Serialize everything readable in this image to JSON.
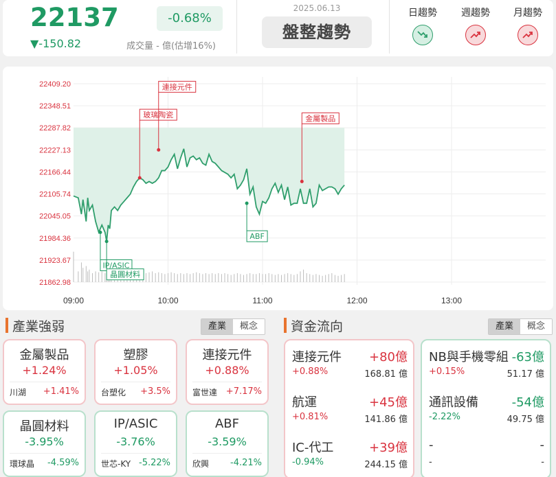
{
  "header": {
    "index_value": "22137",
    "change": "▼-150.82",
    "change_pct": "-0.68%",
    "volume": "成交量 - 億(估增16%)",
    "date": "2025.06.13",
    "trend_label": "盤整趨勢",
    "trends": [
      {
        "label": "日趨勢",
        "direction": "down",
        "color": "#2f9e6c"
      },
      {
        "label": "週趨勢",
        "direction": "up",
        "color": "#d9333f"
      },
      {
        "label": "月趨勢",
        "direction": "up",
        "color": "#d9333f"
      }
    ]
  },
  "chart_data": {
    "type": "line",
    "y_ticks": [
      "22409.20",
      "22348.51",
      "22287.82",
      "22227.13",
      "22166.44",
      "22105.74",
      "22045.05",
      "21984.36",
      "21923.67",
      "21862.98"
    ],
    "ylim": [
      21862.98,
      22409.2
    ],
    "x_ticks": [
      "09:00",
      "10:00",
      "11:00",
      "12:00",
      "13:00"
    ],
    "x_range_minutes": [
      0,
      270
    ],
    "reference_value": 22287.82,
    "series": [
      {
        "x": [
          0,
          3,
          5,
          6,
          8,
          9,
          10,
          12,
          14,
          16,
          18,
          20,
          21,
          22,
          23,
          24,
          26,
          28,
          30,
          32,
          34,
          36,
          38,
          40,
          42,
          44,
          46,
          48,
          50,
          52,
          54,
          56,
          58,
          60,
          62,
          64,
          66,
          68,
          70,
          72,
          74,
          76,
          78,
          80,
          82,
          84,
          86,
          88,
          90,
          92,
          94,
          96,
          98,
          100,
          102,
          104,
          106,
          108,
          110,
          112,
          114,
          116,
          118,
          120,
          122,
          124,
          126,
          128,
          130,
          132,
          134,
          136,
          138,
          140,
          142,
          144,
          146,
          148,
          150,
          152,
          154,
          156,
          158,
          160,
          162,
          164,
          166,
          168,
          170,
          172
        ],
        "values": [
          22100,
          22095,
          22050,
          22090,
          22030,
          22095,
          22060,
          22075,
          22030,
          22000,
          22020,
          22000,
          21975,
          22020,
          22010,
          22060,
          22070,
          22060,
          22075,
          22085,
          22095,
          22105,
          22125,
          22140,
          22150,
          22145,
          22135,
          22140,
          22135,
          22140,
          22150,
          22170,
          22170,
          22180,
          22200,
          22215,
          22175,
          22205,
          22230,
          22180,
          22205,
          22210,
          22200,
          22205,
          22190,
          22185,
          22215,
          22195,
          22190,
          22180,
          22170,
          22165,
          22160,
          22150,
          22160,
          22120,
          22130,
          22145,
          22175,
          22105,
          22125,
          22070,
          22050,
          22085,
          22080,
          22095,
          22120,
          22135,
          22110,
          22130,
          22090,
          22125,
          22075,
          22080,
          22080,
          22120,
          22080,
          22080,
          22120,
          22070,
          22080,
          22130,
          22115,
          22120,
          22125,
          22125,
          22120,
          22105,
          22120,
          22130
        ]
      }
    ],
    "volume_series": [
      34,
      12,
      22,
      16,
      18,
      12,
      14,
      10,
      12,
      11,
      12,
      10,
      11,
      12,
      10,
      12,
      11,
      10,
      12,
      13,
      11,
      12,
      12,
      10,
      11,
      12,
      10,
      11,
      12,
      10,
      11,
      10,
      9,
      10,
      11,
      10,
      9,
      10,
      9,
      10,
      9,
      10,
      11,
      10,
      9,
      10,
      9,
      10,
      9,
      10,
      9,
      10,
      9,
      8,
      9,
      10,
      9,
      8,
      9,
      10,
      9,
      9,
      10,
      9,
      9,
      10,
      9,
      8,
      9,
      8,
      9,
      10,
      9,
      8,
      9,
      12,
      14,
      10,
      9,
      8,
      9,
      8,
      7,
      8,
      9,
      10,
      8,
      7,
      8,
      9
    ],
    "annotations": [
      {
        "label": "IP/ASIC",
        "x": 17,
        "y": 22000,
        "direction": "down",
        "color": "#1f9a63"
      },
      {
        "label": "晶圓材料",
        "x": 21,
        "y": 21975,
        "direction": "down",
        "color": "#1f9a63"
      },
      {
        "label": "玻璃陶瓷",
        "x": 42,
        "y": 22150,
        "direction": "up",
        "color": "#d9333f"
      },
      {
        "label": "連接元件",
        "x": 54,
        "y": 22227,
        "direction": "up",
        "color": "#d9333f"
      },
      {
        "label": "ABF",
        "x": 110,
        "y": 22080,
        "direction": "down",
        "color": "#1f9a63"
      },
      {
        "label": "金屬製品",
        "x": 145,
        "y": 22140,
        "direction": "up",
        "color": "#d9333f"
      }
    ]
  },
  "industry": {
    "title": "產業強弱",
    "toggle": [
      "產業",
      "概念"
    ],
    "cards": [
      {
        "name": "金屬製品",
        "pct": "+1.24%",
        "stock": "川湖",
        "stock_pct": "+1.41%",
        "dir": "up"
      },
      {
        "name": "塑膠",
        "pct": "+1.05%",
        "stock": "台塑化",
        "stock_pct": "+3.5%",
        "dir": "up"
      },
      {
        "name": "連接元件",
        "pct": "+0.88%",
        "stock": "富世達",
        "stock_pct": "+7.17%",
        "dir": "up"
      },
      {
        "name": "晶圓材料",
        "pct": "-3.95%",
        "stock": "環球晶",
        "stock_pct": "-4.59%",
        "dir": "down"
      },
      {
        "name": "IP/ASIC",
        "pct": "-3.76%",
        "stock": "世芯-KY",
        "stock_pct": "-5.22%",
        "dir": "down"
      },
      {
        "name": "ABF",
        "pct": "-3.59%",
        "stock": "欣興",
        "stock_pct": "-4.21%",
        "dir": "down"
      }
    ]
  },
  "flow": {
    "title": "資金流向",
    "toggle": [
      "產業",
      "概念"
    ],
    "inflow": [
      {
        "name": "連接元件",
        "amount": "+80億",
        "pct": "+0.88%",
        "value": "168.81 億"
      },
      {
        "name": "航運",
        "amount": "+45億",
        "pct": "+0.81%",
        "value": "141.86 億"
      },
      {
        "name": "IC-代工",
        "amount": "+39億",
        "pct": "-0.94%",
        "value": "244.15 億",
        "pct_dir": "down"
      }
    ],
    "outflow": [
      {
        "name": "NB與手機零組",
        "amount": "-63億",
        "pct": "+0.15%",
        "value": "51.17 億",
        "pct_dir": "up"
      },
      {
        "name": "通訊設備",
        "amount": "-54億",
        "pct": "-2.22%",
        "value": "49.75 億",
        "pct_dir": "down"
      },
      {
        "name": "-",
        "amount": "-",
        "pct": "-",
        "value": "-"
      }
    ]
  }
}
